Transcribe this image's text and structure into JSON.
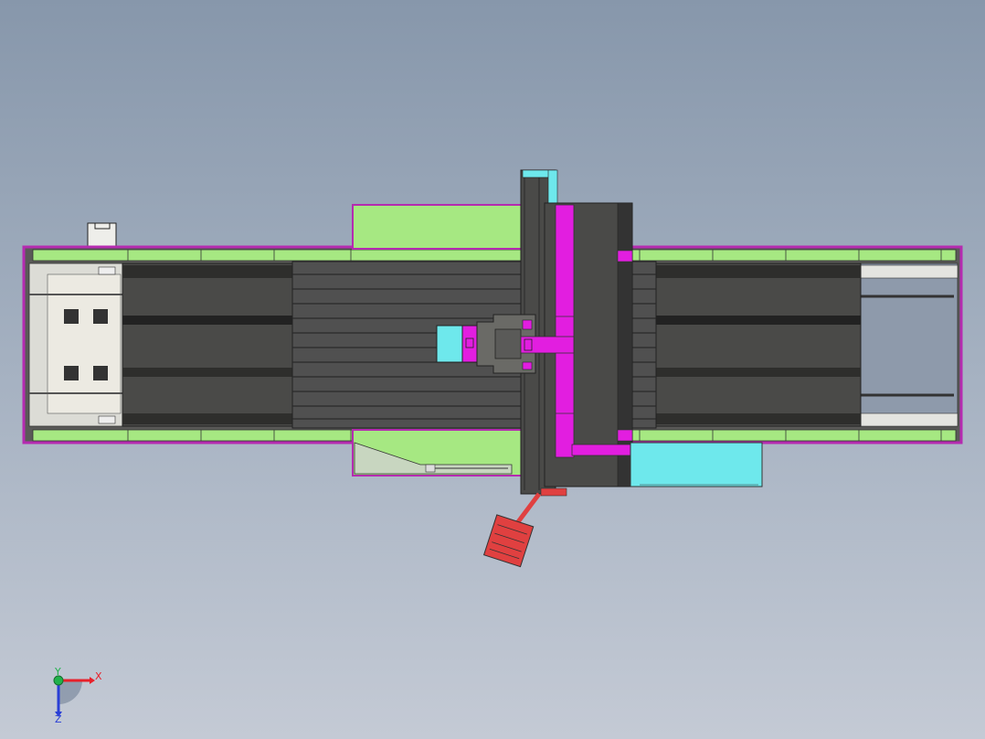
{
  "triad": {
    "x_label": "X",
    "y_label": "Y",
    "z_label": "Z",
    "x_color": "#e8202a",
    "y_color": "#21b24b",
    "z_color": "#2a3fd6"
  },
  "model": {
    "bed_color": "#4a4a48",
    "guard_color": "#a6e882",
    "highlight_color": "#e21ee0",
    "cabinet_color": "#6ee8ec",
    "tool_color": "#e04040",
    "panel_color": "#eceae2"
  }
}
